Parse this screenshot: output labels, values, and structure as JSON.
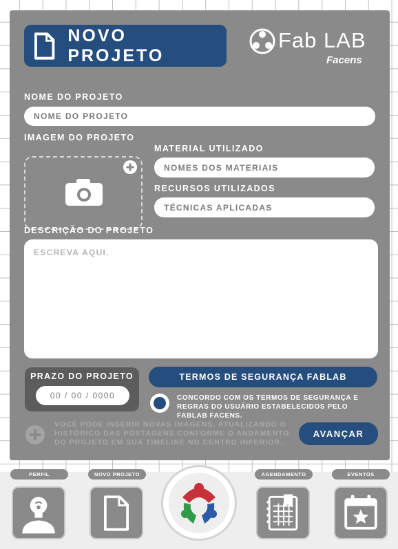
{
  "header": {
    "title": "NOVO PROJETO"
  },
  "logo": {
    "name": "Fab LAB",
    "sub": "Facens"
  },
  "form": {
    "nome_label": "NOME DO PROJETO",
    "nome_placeholder": "NOME DO PROJETO",
    "imagem_label": "IMAGEM DO PROJETO",
    "material_label": "MATERIAL UTILIZADO",
    "material_placeholder": "NOMES DOS MATERIAIS",
    "recursos_label": "RECURSOS UTILIZADOS",
    "recursos_placeholder": "TÉCNICAS APLICADAS",
    "descricao_label": "DESCRIÇÃO DO PROJETO",
    "descricao_placeholder": "ESCREVA AQUI.",
    "prazo_label": "PRAZO DO PROJETO",
    "prazo_value": "00 / 00 / 0000",
    "termos_button": "TERMOS DE SEGURANÇA FABLAB",
    "concordo_text": "CONCORDO COM OS TERMOS DE SEGURANÇA E REGRAS DO USUÁRIO ESTABELECIDOS PELO FABLAB FACENS.",
    "info_text": "VOCÊ PODE INSERIR NOVAS IMAGENS, ATUALIZANDO O HISTÓRICO DAS POSTAGENS CONFORME O ANDAMENTO DO PROJETO EM SUA TIMELINE NO CENTRO INFERIOR.",
    "avancar_button": "AVANÇAR"
  },
  "nav": {
    "items": [
      {
        "label": "PERFIL",
        "icon": "profile-icon"
      },
      {
        "label": "NOVO PROJETO",
        "icon": "document-icon"
      },
      {
        "label": "",
        "icon": "fablab-logo-icon"
      },
      {
        "label": "AGENDAMENTO",
        "icon": "schedule-icon"
      },
      {
        "label": "EVENTOS",
        "icon": "calendar-star-icon"
      }
    ]
  },
  "colors": {
    "accent": "#254d7d",
    "panel": "#8a8a8a",
    "dark_box": "#5c5c5c"
  }
}
